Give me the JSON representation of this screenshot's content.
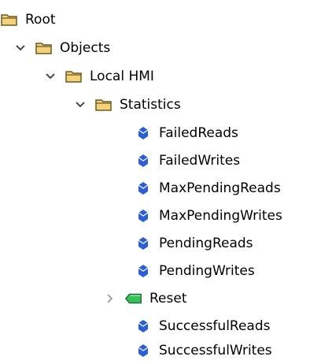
{
  "colors": {
    "folder_fill": "#F3D27A",
    "folder_stroke": "#6A5A22",
    "variable_blue": "#2D5FD3",
    "method_green": "#35C15A",
    "chevron": "#4A4A4A",
    "chevron_collapsed": "#9A9A9A"
  },
  "tree": {
    "root": {
      "label": "Root",
      "icon": "folder-icon"
    },
    "objects": {
      "label": "Objects",
      "icon": "folder-icon",
      "expander": "chevron-down-icon"
    },
    "local_hmi": {
      "label": "Local HMI",
      "icon": "folder-icon",
      "expander": "chevron-down-icon"
    },
    "statistics": {
      "label": "Statistics",
      "icon": "folder-icon",
      "expander": "chevron-down-icon"
    },
    "children": [
      {
        "label": "FailedReads",
        "icon": "variable-icon"
      },
      {
        "label": "FailedWrites",
        "icon": "variable-icon"
      },
      {
        "label": "MaxPendingReads",
        "icon": "variable-icon"
      },
      {
        "label": "MaxPendingWrites",
        "icon": "variable-icon"
      },
      {
        "label": "PendingReads",
        "icon": "variable-icon"
      },
      {
        "label": "PendingWrites",
        "icon": "variable-icon"
      },
      {
        "label": "Reset",
        "icon": "method-icon",
        "expander": "chevron-right-icon"
      },
      {
        "label": "SuccessfulReads",
        "icon": "variable-icon"
      },
      {
        "label": "SuccessfulWrites",
        "icon": "variable-icon"
      }
    ]
  }
}
